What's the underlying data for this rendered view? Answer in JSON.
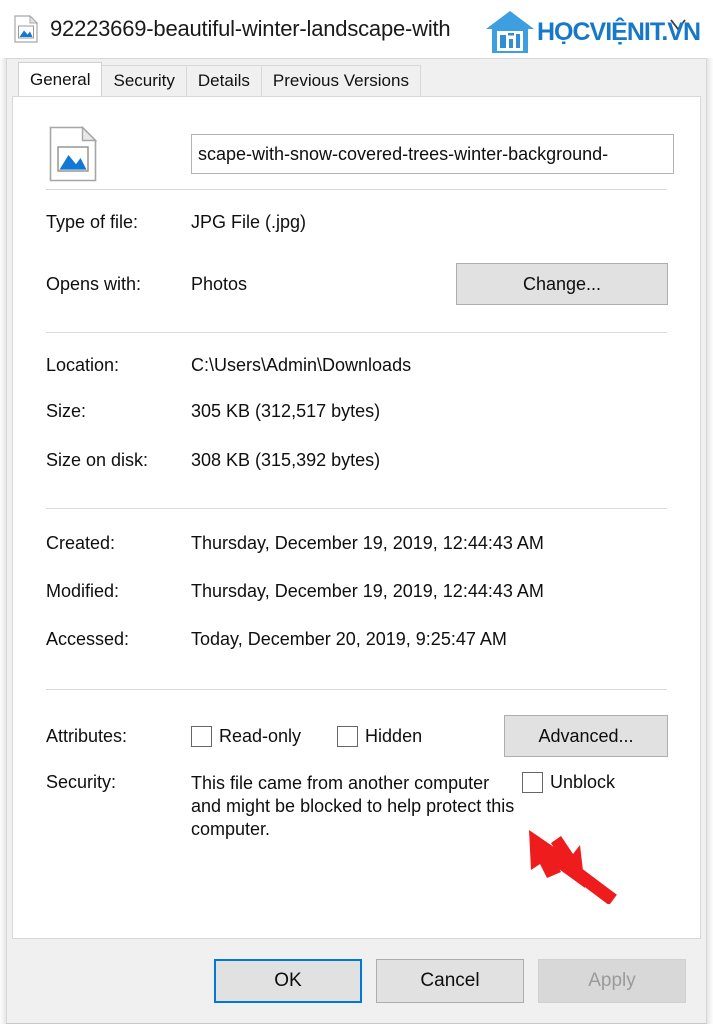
{
  "window": {
    "title": "92223669-beautiful-winter-landscape-with",
    "title_icon": "image-file-icon",
    "close_icon": "close-icon"
  },
  "watermark": {
    "text": "HỌCVIỆNIT.VN",
    "logo_icon": "house-it-logo-icon",
    "color": "#1878c8"
  },
  "tabs": [
    {
      "label": "General",
      "active": true
    },
    {
      "label": "Security",
      "active": false
    },
    {
      "label": "Details",
      "active": false
    },
    {
      "label": "Previous Versions",
      "active": false
    }
  ],
  "file": {
    "icon": "image-file-icon",
    "name_value": "scape-with-snow-covered-trees-winter-background-"
  },
  "properties": {
    "type_label": "Type of file:",
    "type_value": "JPG File (.jpg)",
    "opens_with_label": "Opens with:",
    "opens_with_value": "Photos",
    "change_button": "Change...",
    "location_label": "Location:",
    "location_value": "C:\\Users\\Admin\\Downloads",
    "size_label": "Size:",
    "size_value": "305 KB (312,517 bytes)",
    "size_on_disk_label": "Size on disk:",
    "size_on_disk_value": "308 KB (315,392 bytes)",
    "created_label": "Created:",
    "created_value": "Thursday, December 19, 2019, 12:44:43 AM",
    "modified_label": "Modified:",
    "modified_value": "Thursday, December 19, 2019, 12:44:43 AM",
    "accessed_label": "Accessed:",
    "accessed_value": "Today, December 20, 2019, 9:25:47 AM"
  },
  "attributes": {
    "label": "Attributes:",
    "read_only_label": "Read-only",
    "read_only_checked": false,
    "hidden_label": "Hidden",
    "hidden_checked": false,
    "advanced_button": "Advanced..."
  },
  "security": {
    "label": "Security:",
    "message": "This file came from another computer and might be blocked to help protect this computer.",
    "unblock_label": "Unblock",
    "unblock_checked": false
  },
  "annotation": {
    "arrow_icon": "red-arrow-pointer-icon",
    "color": "#ee1c1c",
    "points_to": "unblock-checkbox"
  },
  "footer": {
    "ok_label": "OK",
    "cancel_label": "Cancel",
    "apply_label": "Apply",
    "apply_disabled": true,
    "focus_color": "#0078d7"
  }
}
